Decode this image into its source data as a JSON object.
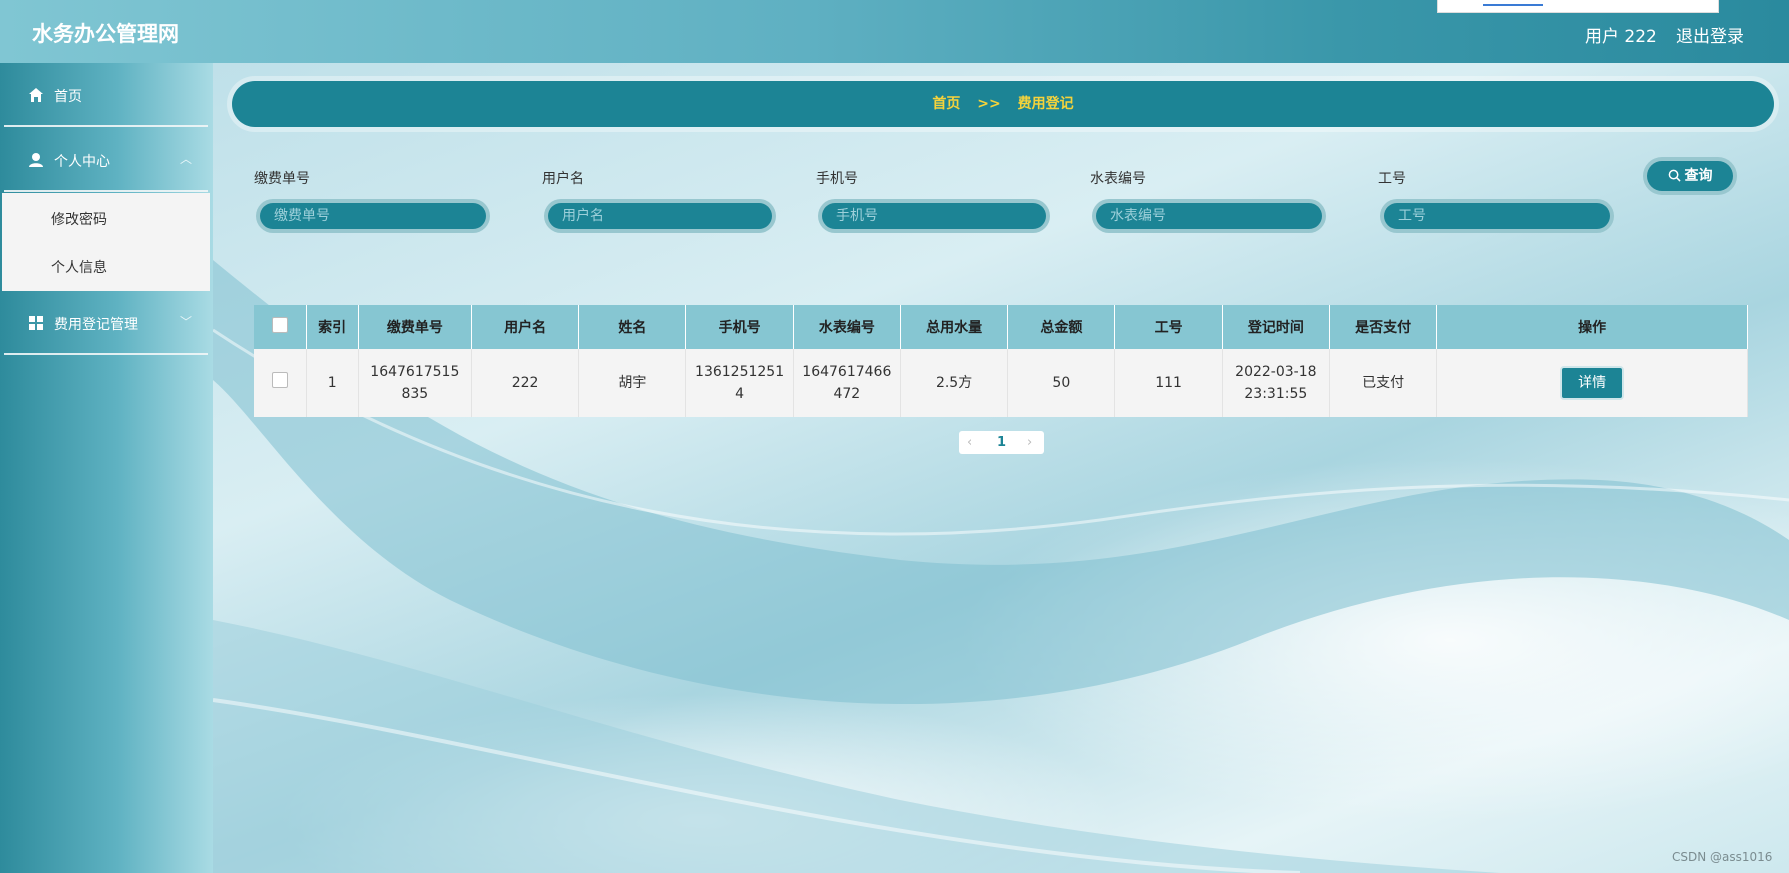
{
  "header": {
    "brand": "水务办公管理网",
    "user_label": "用户 222",
    "logout": "退出登录"
  },
  "sidebar": {
    "items": [
      {
        "label": "首页",
        "icon": "home-icon"
      },
      {
        "label": "个人中心",
        "icon": "user-icon",
        "expanded": true,
        "children": [
          {
            "label": "修改密码"
          },
          {
            "label": "个人信息"
          }
        ]
      },
      {
        "label": "费用登记管理",
        "icon": "grid-icon",
        "expanded": false
      }
    ]
  },
  "breadcrumb": {
    "home": "首页",
    "separator": ">>",
    "current": "费用登记"
  },
  "search": {
    "fields": [
      {
        "label": "缴费单号",
        "placeholder": "缴费单号"
      },
      {
        "label": "用户名",
        "placeholder": "用户名"
      },
      {
        "label": "手机号",
        "placeholder": "手机号"
      },
      {
        "label": "水表编号",
        "placeholder": "水表编号"
      },
      {
        "label": "工号",
        "placeholder": "工号"
      }
    ],
    "button": "查询"
  },
  "table": {
    "headers": [
      "索引",
      "缴费单号",
      "用户名",
      "姓名",
      "手机号",
      "水表编号",
      "总用水量",
      "总金额",
      "工号",
      "登记时间",
      "是否支付",
      "操作"
    ],
    "rows": [
      {
        "index": "1",
        "bill_no_1": "1647617515",
        "bill_no_2": "835",
        "username": "222",
        "name": "胡宇",
        "phone_1": "1361251251",
        "phone_2": "4",
        "meter_1": "1647617466",
        "meter_2": "472",
        "water": "2.5方",
        "amount": "50",
        "staff_no": "111",
        "date": "2022-03-18",
        "time": "23:31:55",
        "paid": "已支付",
        "action": "详情"
      }
    ]
  },
  "pagination": {
    "prev": "‹",
    "current": "1",
    "next": "›"
  },
  "watermark": "CSDN @ass1016",
  "colors": {
    "primary": "#1c8495",
    "header_text": "#ffffff",
    "breadcrumb_text": "#f5d33b"
  }
}
